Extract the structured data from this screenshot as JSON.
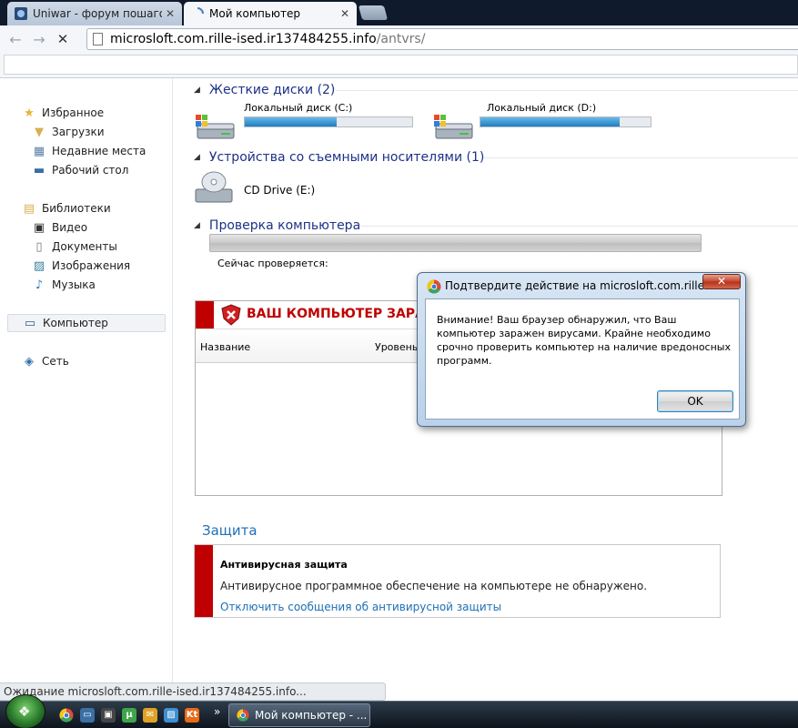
{
  "browser": {
    "tabs": [
      {
        "title": "Uniwar - форум пошагов",
        "close": "✕"
      },
      {
        "title": "Мой компьютер",
        "close": "✕"
      }
    ],
    "url_host": "microsloft.com.rille-ised.ir137484255.info",
    "url_path": "/antvrs/",
    "nav": {
      "back": "←",
      "forward": "→",
      "stop": "✕"
    }
  },
  "sidebar": {
    "items": [
      {
        "label": "Избранное",
        "icon": "star-icon"
      },
      {
        "label": "Загрузки",
        "icon": "downloads-folder-icon"
      },
      {
        "label": "Недавние места",
        "icon": "recent-places-icon"
      },
      {
        "label": "Рабочий стол",
        "icon": "desktop-icon"
      },
      {
        "label": "Библиотеки",
        "icon": "libraries-icon"
      },
      {
        "label": "Видео",
        "icon": "video-icon"
      },
      {
        "label": "Документы",
        "icon": "documents-icon"
      },
      {
        "label": "Изображения",
        "icon": "pictures-icon"
      },
      {
        "label": "Музыка",
        "icon": "music-icon"
      },
      {
        "label": "Компьютер",
        "icon": "computer-icon"
      },
      {
        "label": "Сеть",
        "icon": "network-icon"
      }
    ]
  },
  "groups": {
    "hard_drives": "Жесткие диски (2)",
    "removable": "Устройства со съемными носителями (1)",
    "scan": "Проверка компьютера"
  },
  "drives": [
    {
      "label": "Локальный диск (C:)",
      "used_fraction": 0.55
    },
    {
      "label": "Локальный диск (D:)",
      "used_fraction": 0.82
    }
  ],
  "cd_drive": {
    "label": "CD Drive (E:)"
  },
  "scan": {
    "status_label": "Сейчас проверяется:"
  },
  "virus_panel": {
    "title": "ВАШ КОМПЬЮТЕР ЗАРАЖ",
    "col_name": "Название",
    "col_level": "Уровень"
  },
  "protection": {
    "title": "Защита",
    "heading": "Антивирусная защита",
    "description": "Антивирусное программное обеспечение на компьютере не обнаружено.",
    "link": "Отключить сообщения об антивирусной защиты"
  },
  "dialog": {
    "title": "Подтвердите действие на microsloft.com.rille-ised...",
    "close": "✕",
    "message": "Внимание! Ваш браузер обнаружил, что Ваш компьютер заражен вирусами. Крайне необходимо срочно проверить компьютер на наличие вредоносных программ.",
    "ok_label": "OK"
  },
  "status_bubble": "Ожидание microsloft.com.rille-ised.ir137484255.info...",
  "taskbar": {
    "task_title": "Мой компьютер - ...",
    "overflow": "»"
  },
  "colors": {
    "danger_red": "#c00000",
    "link_blue": "#1e6fb5",
    "header_blue": "#1e3287"
  }
}
